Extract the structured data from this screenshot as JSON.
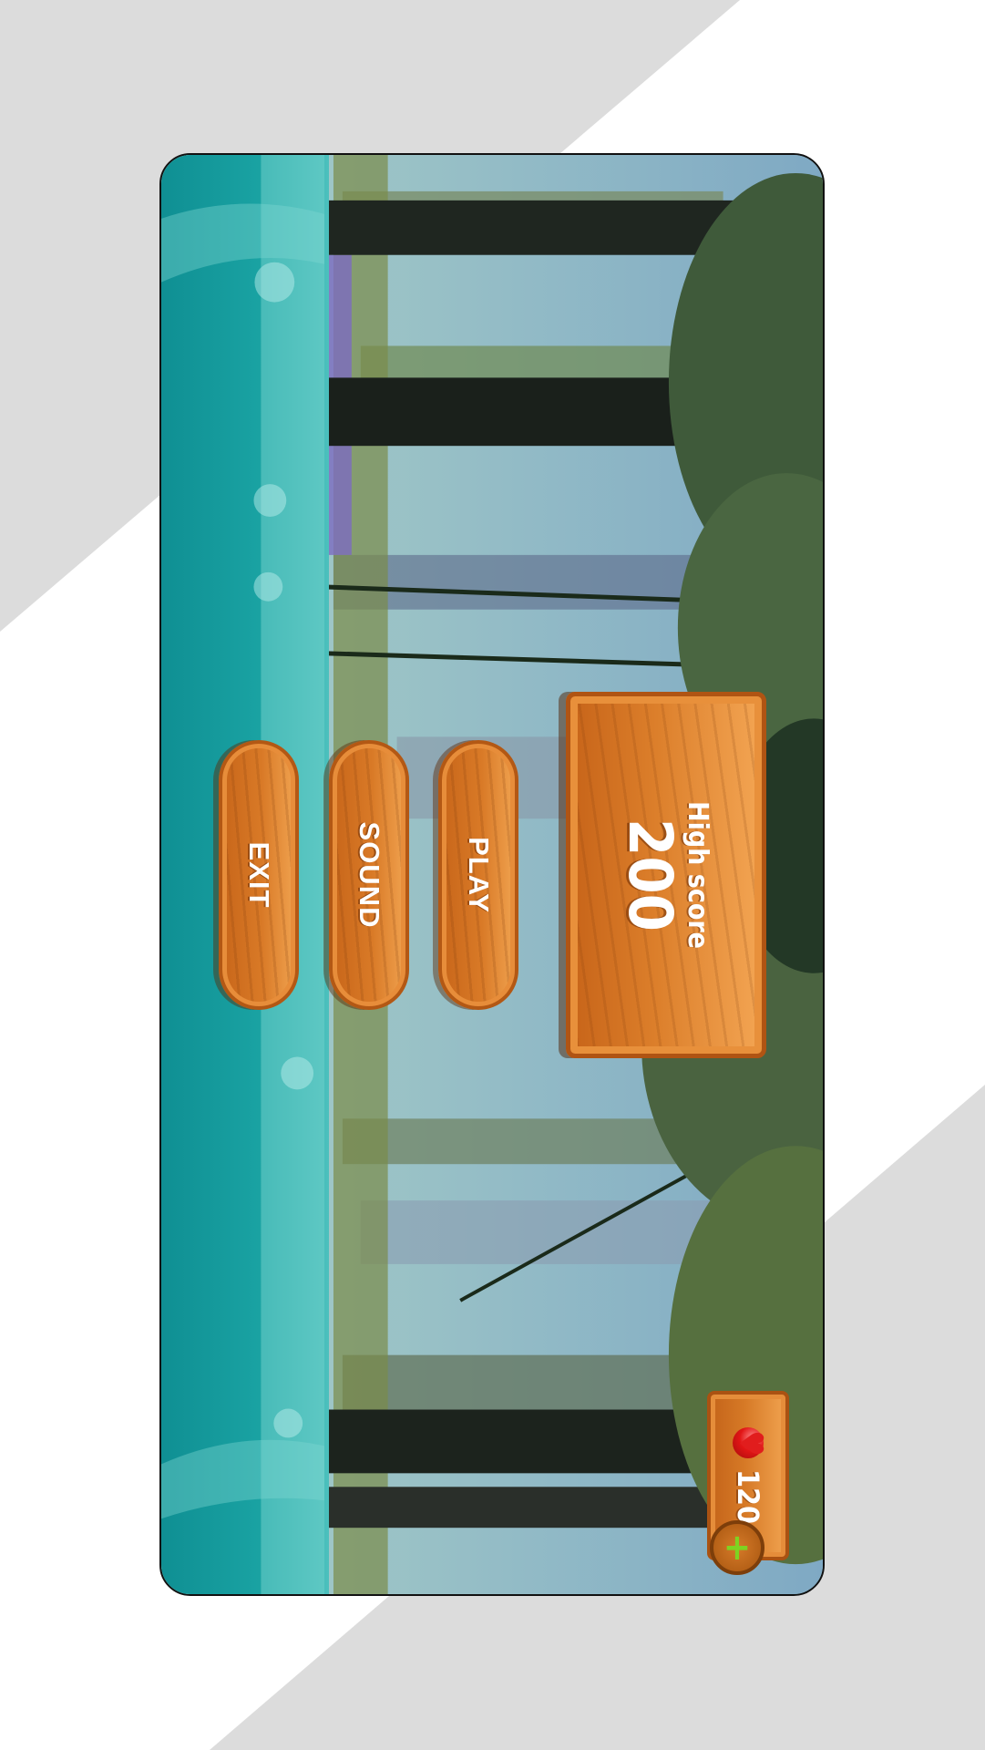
{
  "menu": {
    "play_label": "PLAY",
    "sound_label": "SOUND",
    "exit_label": "EXIT"
  },
  "high_score": {
    "title": "High score",
    "value": "200"
  },
  "lives": {
    "value": "120",
    "icon": "heart-icon",
    "add_icon": "plus-icon"
  },
  "colors": {
    "wood": "#dc7f2b",
    "wood_border": "#b05413",
    "water": "#1aa3a3",
    "plus": "#7ed321",
    "heart": "#e11d1d"
  }
}
